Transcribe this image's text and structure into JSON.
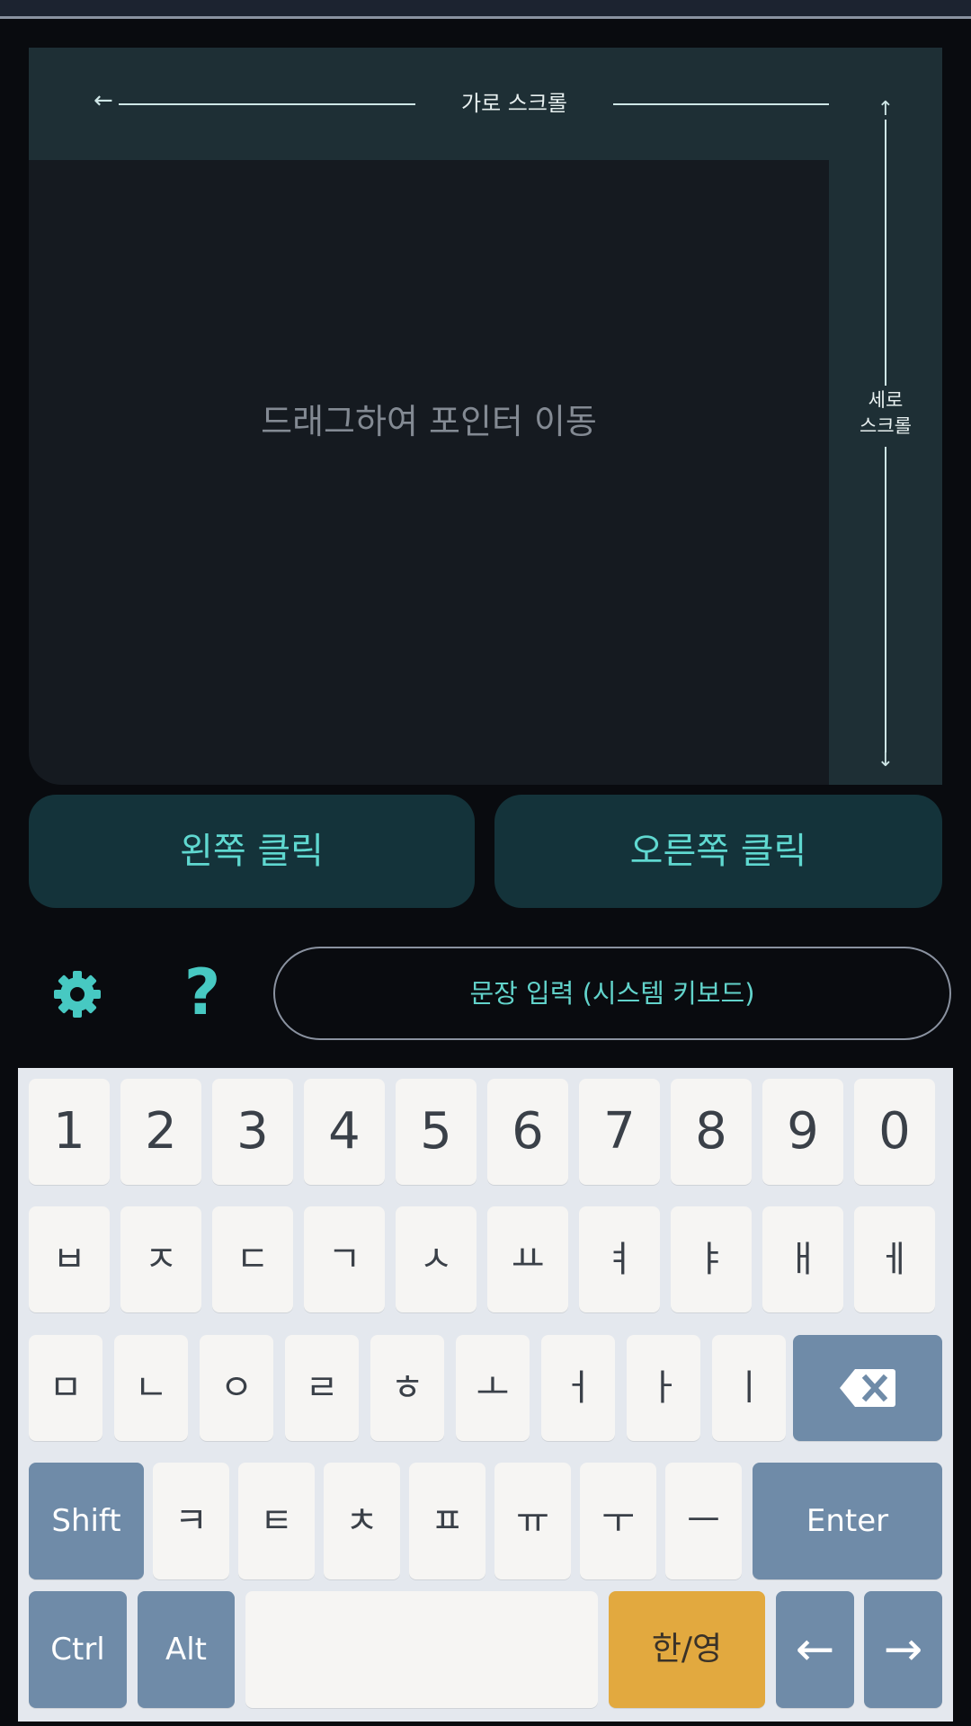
{
  "touchpad": {
    "horizontal_scroll_label": "가로 스크롤",
    "vertical_scroll_label": "세로\n스크롤",
    "hint": "드래그하여 포인터 이동",
    "left_arrow": "←",
    "up_arrow": "↑",
    "down_arrow": "↓"
  },
  "buttons": {
    "left_click": "왼쪽 클릭",
    "right_click": "오른쪽 클릭"
  },
  "toolbar": {
    "settings_icon": "gear-icon",
    "help_label": "?",
    "sentence_input": "문장 입력 (시스템 키보드)"
  },
  "keyboard": {
    "row1": [
      "1",
      "2",
      "3",
      "4",
      "5",
      "6",
      "7",
      "8",
      "9",
      "0"
    ],
    "row2": [
      "ㅂ",
      "ㅈ",
      "ㄷ",
      "ㄱ",
      "ㅅ",
      "ㅛ",
      "ㅕ",
      "ㅑ",
      "ㅐ",
      "ㅔ"
    ],
    "row3": [
      "ㅁ",
      "ㄴ",
      "ㅇ",
      "ㄹ",
      "ㅎ",
      "ㅗ",
      "ㅓ",
      "ㅏ",
      "ㅣ"
    ],
    "backspace_icon": "backspace-icon",
    "shift": "Shift",
    "row4": [
      "ㅋ",
      "ㅌ",
      "ㅊ",
      "ㅍ",
      "ㅠ",
      "ㅜ",
      "ㅡ"
    ],
    "enter": "Enter",
    "ctrl": "Ctrl",
    "alt": "Alt",
    "lang": "한/영",
    "left_arrow": "←",
    "right_arrow": "→"
  },
  "colors": {
    "accent": "#5fd8d0",
    "modifier_key": "#6f8ba8",
    "lang_key": "#e2a93f",
    "scroll_strip": "#1e2f35"
  }
}
